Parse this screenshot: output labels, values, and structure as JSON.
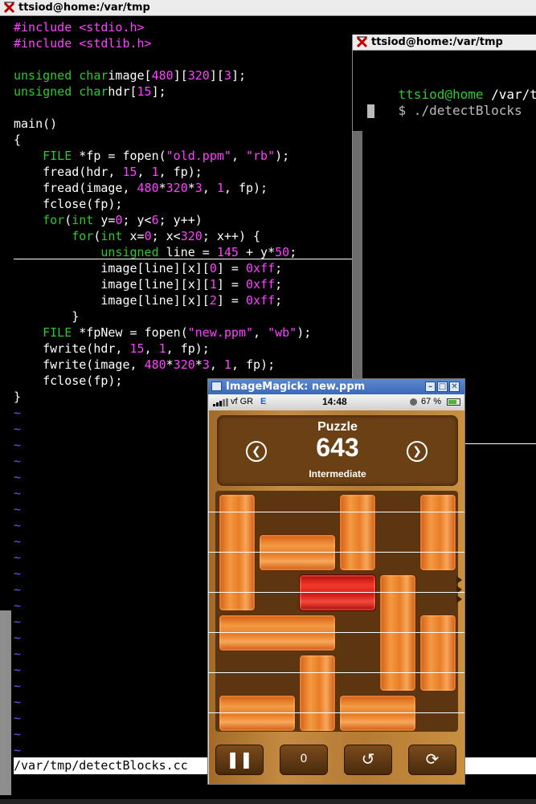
{
  "terminal_main": {
    "title": "ttsiod@home:/var/tmp",
    "code_lines": [
      [
        [
          "pp",
          "#include "
        ],
        [
          "st",
          "<stdio.h>"
        ]
      ],
      [
        [
          "pp",
          "#include "
        ],
        [
          "st",
          "<stdlib.h>"
        ]
      ],
      [],
      [
        [
          "ty",
          "unsigned char"
        ],
        [
          "",
          "image["
        ],
        [
          "nu",
          "480"
        ],
        [
          "",
          "]["
        ],
        [
          "nu",
          "320"
        ],
        [
          "",
          "]["
        ],
        [
          "nu",
          "3"
        ],
        [
          "",
          "];"
        ]
      ],
      [
        [
          "ty",
          "unsigned char"
        ],
        [
          "",
          "hdr["
        ],
        [
          "nu",
          "15"
        ],
        [
          "",
          "];"
        ]
      ],
      [],
      [
        [
          "",
          "main()"
        ]
      ],
      [
        [
          "",
          "{"
        ]
      ],
      [
        [
          "",
          "    "
        ],
        [
          "ty",
          "FILE"
        ],
        [
          "",
          " *fp = fopen("
        ],
        [
          "st",
          "\"old.ppm\""
        ],
        [
          "",
          ", "
        ],
        [
          "st",
          "\"rb\""
        ],
        [
          "",
          ");"
        ]
      ],
      [
        [
          "",
          "    fread(hdr, "
        ],
        [
          "nu",
          "15"
        ],
        [
          "",
          ", "
        ],
        [
          "nu",
          "1"
        ],
        [
          "",
          ", fp);"
        ]
      ],
      [
        [
          "",
          "    fread(image, "
        ],
        [
          "nu",
          "480"
        ],
        [
          "",
          "*"
        ],
        [
          "nu",
          "320"
        ],
        [
          "",
          "*"
        ],
        [
          "nu",
          "3"
        ],
        [
          "",
          ", "
        ],
        [
          "nu",
          "1"
        ],
        [
          "",
          ", fp);"
        ]
      ],
      [
        [
          "",
          "    fclose(fp);"
        ]
      ],
      [
        [
          "",
          "    "
        ],
        [
          "ty",
          "for"
        ],
        [
          "",
          "("
        ],
        [
          "ty",
          "int"
        ],
        [
          "",
          " y="
        ],
        [
          "nu",
          "0"
        ],
        [
          "",
          "; y<"
        ],
        [
          "nu",
          "6"
        ],
        [
          "",
          "; y++)"
        ]
      ],
      [
        [
          "",
          "        "
        ],
        [
          "ty",
          "for"
        ],
        [
          "",
          "("
        ],
        [
          "ty",
          "int"
        ],
        [
          "",
          " x="
        ],
        [
          "nu",
          "0"
        ],
        [
          "",
          "; x<"
        ],
        [
          "nu",
          "320"
        ],
        [
          "",
          "; x++) {"
        ]
      ],
      [
        [
          "",
          "            "
        ],
        [
          "ty",
          "unsigned"
        ],
        [
          "",
          " line = "
        ],
        [
          "nu",
          "145"
        ],
        [
          "",
          " + y*"
        ],
        [
          "nu",
          "50"
        ],
        [
          "",
          ";"
        ]
      ],
      [
        [
          "",
          "            image[line][x]["
        ],
        [
          "nu",
          "0"
        ],
        [
          "",
          "] = "
        ],
        [
          "nu",
          "0xff"
        ],
        [
          "",
          ";"
        ]
      ],
      [
        [
          "",
          "            image[line][x]["
        ],
        [
          "nu",
          "1"
        ],
        [
          "",
          "] = "
        ],
        [
          "nu",
          "0xff"
        ],
        [
          "",
          ";"
        ]
      ],
      [
        [
          "",
          "            image[line][x]["
        ],
        [
          "nu",
          "2"
        ],
        [
          "",
          "] = "
        ],
        [
          "nu",
          "0xff"
        ],
        [
          "",
          ";"
        ]
      ],
      [
        [
          "",
          "        }"
        ]
      ],
      [
        [
          "",
          "    "
        ],
        [
          "ty",
          "FILE"
        ],
        [
          "",
          " *fpNew = fopen("
        ],
        [
          "st",
          "\"new.ppm\""
        ],
        [
          "",
          ", "
        ],
        [
          "st",
          "\"wb\""
        ],
        [
          "",
          ");"
        ]
      ],
      [
        [
          "",
          "    fwrite(hdr, "
        ],
        [
          "nu",
          "15"
        ],
        [
          "",
          ", "
        ],
        [
          "nu",
          "1"
        ],
        [
          "",
          ", fp);"
        ]
      ],
      [
        [
          "",
          "    fwrite(image, "
        ],
        [
          "nu",
          "480"
        ],
        [
          "",
          "*"
        ],
        [
          "nu",
          "320"
        ],
        [
          "",
          "*"
        ],
        [
          "nu",
          "3"
        ],
        [
          "",
          ", "
        ],
        [
          "nu",
          "1"
        ],
        [
          "",
          ", fp);"
        ]
      ],
      [
        [
          "",
          "    fclose(fp);"
        ]
      ],
      [
        [
          "",
          "}"
        ]
      ]
    ],
    "tilde": "~",
    "tilde_count": 22,
    "statusline": "/var/tmp/detectBlocks.cc"
  },
  "terminal_second": {
    "title": "ttsiod@home:/var/tmp",
    "prompt_user": "ttsiod@home",
    "prompt_path": " /var/tmp",
    "prompt_symbol": "$",
    "command": " ./detectBlocks"
  },
  "image_window": {
    "title": "ImageMagick: new.ppm",
    "status": {
      "carrier": "vf GR",
      "network": "E",
      "time": "14:48",
      "battery": "67 %"
    },
    "puzzle_label": "Puzzle",
    "puzzle_number": "643",
    "difficulty": "Intermediate",
    "prev_icon": "chevron-left-icon",
    "next_icon": "chevron-right-icon",
    "toolbar_icons": [
      "pause-icon",
      "hint-icon",
      "undo-icon",
      "restart-icon"
    ],
    "hint_count": "0",
    "colors": {
      "wood": "#c58b42",
      "block": "#e97d26",
      "red_block": "#d41818",
      "board": "#5b3611"
    }
  }
}
